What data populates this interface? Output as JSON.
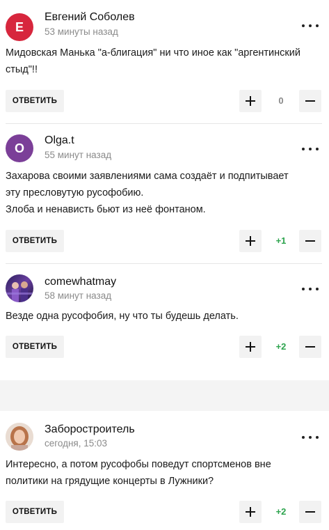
{
  "colors": {
    "zero_score": "#888888",
    "positive_score": "#2da44e",
    "gap_bg": "#f4f4f4"
  },
  "comments": [
    {
      "avatar_letter": "Е",
      "avatar_color": "#d7263d",
      "author": "Евгений Соболев",
      "time": "53 минуты назад",
      "text_lines": [
        "Мидовская Манька \"а-блигация\" ни что иное как \"аргентинский",
        "стыд\"!!"
      ],
      "reply_label": "ОТВЕТИТЬ",
      "score": "0"
    },
    {
      "avatar_letter": "O",
      "avatar_color": "#7b3f98",
      "author": "Olga.t",
      "time": "55 минут назад",
      "text_lines": [
        "Захарова своими заявлениями сама создаёт и подпитывает",
        "эту пресловутую русофобию.",
        "Злоба и ненависть бьют из неё фонтаном."
      ],
      "reply_label": "ОТВЕТИТЬ",
      "score": "+1"
    },
    {
      "avatar_letter": "",
      "avatar_color": "#3a2a6e",
      "author": "comewhatmay",
      "time": "58 минут назад",
      "text_lines": [
        "Везде одна русофобия, ну что ты будешь делать."
      ],
      "reply_label": "ОТВЕТИТЬ",
      "score": "+2"
    },
    {
      "avatar_letter": "",
      "avatar_color": "#d9a38a",
      "author": "Заборостроитель",
      "time": "сегодня, 15:03",
      "text_lines": [
        "Интересно, а потом русофобы поведут спортсменов вне",
        "политики на грядущие концерты в Лужники?"
      ],
      "reply_label": "ОТВЕТИТЬ",
      "score": "+2"
    }
  ]
}
